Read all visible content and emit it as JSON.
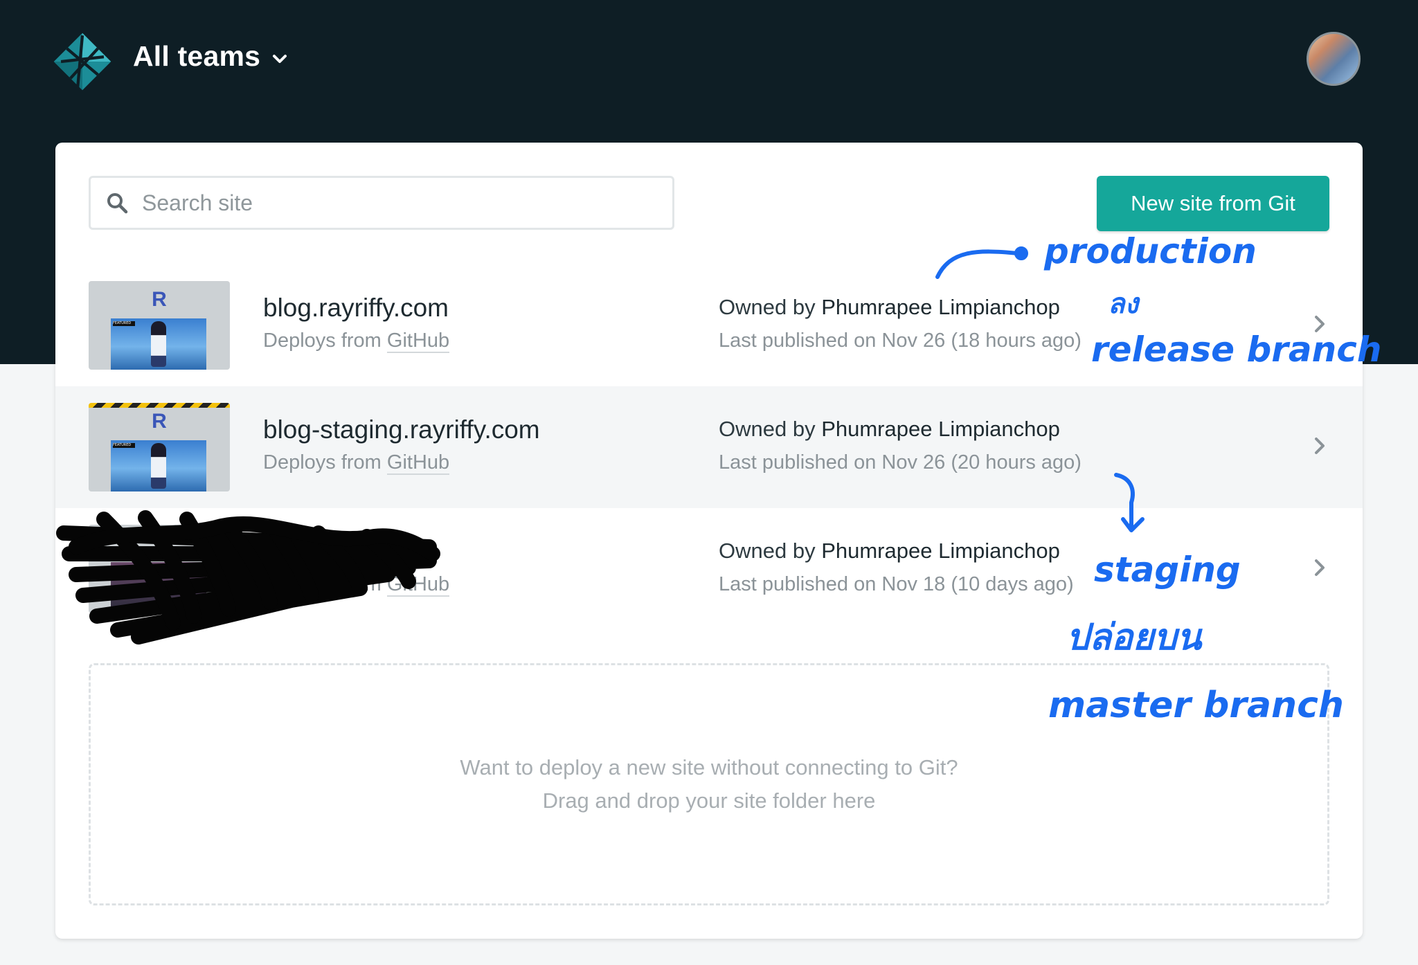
{
  "header": {
    "team_switcher_label": "All teams"
  },
  "toolbar": {
    "search_placeholder": "Search site",
    "new_site_label": "New site from Git"
  },
  "sites": [
    {
      "name": "blog.rayriffy.com",
      "deploys_prefix": "Deploys from",
      "deploys_source": "GitHub",
      "owned_prefix": "Owned by",
      "owner": "Phumrapee Limpianchop",
      "published": "Last published on Nov 26 (18 hours ago)",
      "thumb_letter": "R"
    },
    {
      "name": "blog-staging.rayriffy.com",
      "deploys_prefix": "Deploys from",
      "deploys_source": "GitHub",
      "owned_prefix": "Owned by",
      "owner": "Phumrapee Limpianchop",
      "published": "Last published on Nov 26 (20 hours ago)",
      "thumb_letter": "R"
    },
    {
      "name": "",
      "deploys_prefix": "Deploys from",
      "deploys_source": "GitHub",
      "owned_prefix": "Owned by",
      "owner": "Phumrapee Limpianchop",
      "published": "Last published on Nov 18 (10 days ago)"
    }
  ],
  "dropzone": {
    "line1": "Want to deploy a new site without connecting to Git?",
    "line2": "Drag and drop your site folder here"
  },
  "annotations": {
    "note_production": "production",
    "note_thai_1": "ลง",
    "note_release": "release branch",
    "note_staging": "staging",
    "note_thai_2": "ปล่อยบน",
    "note_master": "master branch"
  },
  "colors": {
    "header_bg": "#0e1e25",
    "accent_button": "#15a79a",
    "annotation_ink": "#1a6bf0"
  },
  "icons": {
    "logo": "netlify-logo-icon",
    "team_dropdown": "chevron-down-icon",
    "search": "search-icon",
    "row_arrow": "chevron-right-icon"
  }
}
